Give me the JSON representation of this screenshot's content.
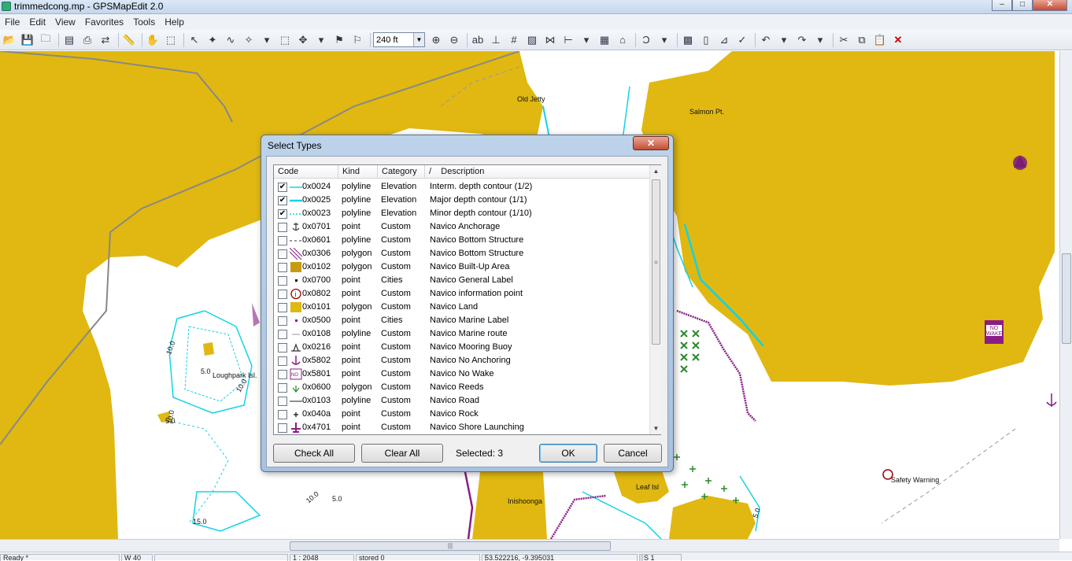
{
  "window": {
    "title": "trimmedcong.mp - GPSMapEdit 2.0",
    "min": "–",
    "max": "□",
    "close": "✕"
  },
  "menu": [
    {
      "label": "File"
    },
    {
      "label": "Edit"
    },
    {
      "label": "View"
    },
    {
      "label": "Favorites"
    },
    {
      "label": "Tools"
    },
    {
      "label": "Help"
    }
  ],
  "toolbar": {
    "zoom_value": "240 ft"
  },
  "map": {
    "labels": [
      {
        "text": "Old Jetty",
        "name": "map-label-old-jetty"
      },
      {
        "text": "Salmon Pt.",
        "name": "map-label-salmon-pt"
      },
      {
        "text": "Loughpark Isl.",
        "name": "map-label-loughpark-isl"
      },
      {
        "text": "Leaf Isl",
        "name": "map-label-leaf-isl"
      },
      {
        "text": "Inishoonga",
        "name": "map-label-inishoonga"
      },
      {
        "text": "Safety Warning",
        "name": "map-label-safety-warning"
      },
      {
        "text": "10.0",
        "name": "depth-label"
      },
      {
        "text": "5.0",
        "name": "depth-label"
      },
      {
        "text": "10.0",
        "name": "depth-label"
      },
      {
        "text": "10.0",
        "name": "depth-label"
      },
      {
        "text": "5.0",
        "name": "depth-label"
      },
      {
        "text": "10.0",
        "name": "depth-label"
      },
      {
        "text": "5.0",
        "name": "depth-label"
      },
      {
        "text": "15.0",
        "name": "depth-label"
      },
      {
        "text": "50",
        "name": "depth-label"
      },
      {
        "text": "5.0",
        "name": "depth-label"
      }
    ],
    "no_wake_sign": "NO WAKE"
  },
  "dialog": {
    "title": "Select Types",
    "close": "✕",
    "columns": {
      "code": "Code",
      "kind": "Kind",
      "category": "Category",
      "sort": "/",
      "description": "Description"
    },
    "rows": [
      {
        "checked": "✔",
        "code": "0x0024",
        "kind": "polyline",
        "category": "Elevation",
        "description": "Interm. depth contour (1/2)",
        "symbol": "line-cyan"
      },
      {
        "checked": "✔",
        "code": "0x0025",
        "kind": "polyline",
        "category": "Elevation",
        "description": "Major depth contour (1/1)",
        "symbol": "line-cyan-thick"
      },
      {
        "checked": "✔",
        "code": "0x0023",
        "kind": "polyline",
        "category": "Elevation",
        "description": "Minor depth contour (1/10)",
        "symbol": "line-cyan-dash"
      },
      {
        "checked": "",
        "code": "0x0701",
        "kind": "point",
        "category": "Custom",
        "description": "Navico Anchorage",
        "symbol": "anchor"
      },
      {
        "checked": "",
        "code": "0x0601",
        "kind": "polyline",
        "category": "Custom",
        "description": "Navico Bottom Structure",
        "symbol": "line-dash"
      },
      {
        "checked": "",
        "code": "0x0306",
        "kind": "polygon",
        "category": "Custom",
        "description": "Navico Bottom Structure",
        "symbol": "hatch"
      },
      {
        "checked": "",
        "code": "0x0102",
        "kind": "polygon",
        "category": "Custom",
        "description": "Navico Built-Up Area",
        "symbol": "fill-gold"
      },
      {
        "checked": "",
        "code": "0x0700",
        "kind": "point",
        "category": "Cities",
        "description": "Navico General Label",
        "symbol": "dot"
      },
      {
        "checked": "",
        "code": "0x0802",
        "kind": "point",
        "category": "Custom",
        "description": "Navico information point",
        "symbol": "info"
      },
      {
        "checked": "",
        "code": "0x0101",
        "kind": "polygon",
        "category": "Custom",
        "description": "Navico Land",
        "symbol": "fill-land"
      },
      {
        "checked": "",
        "code": "0x0500",
        "kind": "point",
        "category": "Cities",
        "description": "Navico Marine Label",
        "symbol": "dot-purple"
      },
      {
        "checked": "",
        "code": "0x0108",
        "kind": "polyline",
        "category": "Custom",
        "description": "Navico Marine route",
        "symbol": "line-gray"
      },
      {
        "checked": "",
        "code": "0x0216",
        "kind": "point",
        "category": "Custom",
        "description": "Navico Mooring Buoy",
        "symbol": "buoy"
      },
      {
        "checked": "",
        "code": "0x5802",
        "kind": "point",
        "category": "Custom",
        "description": "Navico No Anchoring",
        "symbol": "no-anchor"
      },
      {
        "checked": "",
        "code": "0x5801",
        "kind": "point",
        "category": "Custom",
        "description": "Navico No Wake",
        "symbol": "no-wake"
      },
      {
        "checked": "",
        "code": "0x0600",
        "kind": "polygon",
        "category": "Custom",
        "description": "Navico Reeds",
        "symbol": "reeds"
      },
      {
        "checked": "",
        "code": "0x0103",
        "kind": "polyline",
        "category": "Custom",
        "description": "Navico Road",
        "symbol": "line-black"
      },
      {
        "checked": "",
        "code": "0x040a",
        "kind": "point",
        "category": "Custom",
        "description": "Navico Rock",
        "symbol": "plus"
      },
      {
        "checked": "",
        "code": "0x4701",
        "kind": "point",
        "category": "Custom",
        "description": "Navico Shore Launching",
        "symbol": "launch"
      }
    ],
    "buttons": {
      "check_all": "Check All",
      "clear_all": "Clear All",
      "ok": "OK",
      "cancel": "Cancel"
    },
    "selected_text": "Selected: 3"
  },
  "status": [
    {
      "text": "Ready *"
    },
    {
      "text": "W 40"
    },
    {
      "text": ""
    },
    {
      "text": "1 : 2048"
    },
    {
      "text": "stored 0"
    },
    {
      "text": ""
    },
    {
      "text": "53.522216, -9.395031"
    },
    {
      "text": ""
    },
    {
      "text": "S 1"
    }
  ],
  "colors": {
    "land": "#e0b811",
    "contour": "#14d2e6",
    "route": "#8a1c86",
    "dialog_accent": "#3c7fb1"
  }
}
